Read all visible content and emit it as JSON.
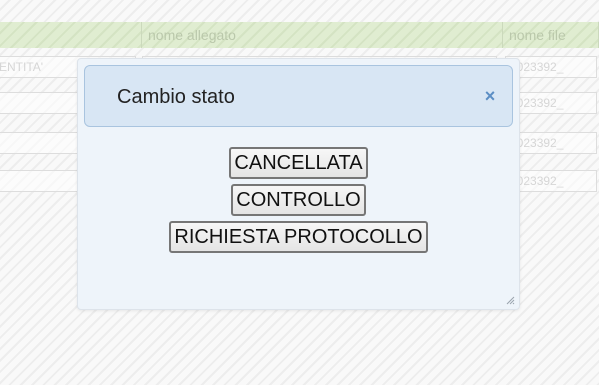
{
  "background_table": {
    "columns": [
      "",
      "nome allegato",
      "nome file"
    ],
    "rows": [
      {
        "c1": "ENTITA'",
        "c2": "",
        "c3": "1023392_"
      },
      {
        "c1": "",
        "c2": "",
        "c3": "1023392_"
      },
      {
        "c1": "",
        "c2": "",
        "c3": "1023392_"
      },
      {
        "c1": "",
        "c2": "",
        "c3": "1023392_"
      }
    ]
  },
  "dialog": {
    "title": "Cambio stato",
    "close_symbol": "×",
    "close_icon": "close-icon",
    "resize_icon": "resize-grip-icon",
    "buttons": [
      {
        "label": "CANCELLATA"
      },
      {
        "label": "CONTROLLO"
      },
      {
        "label": "RICHIESTA PROTOCOLLO"
      }
    ]
  },
  "colors": {
    "header_green": "#c9ddb3",
    "dialog_background": "#eef4fa",
    "titlebar_background": "#d8e6f4",
    "titlebar_border": "#a9c4df",
    "close_icon_color": "#5b8ec4"
  }
}
